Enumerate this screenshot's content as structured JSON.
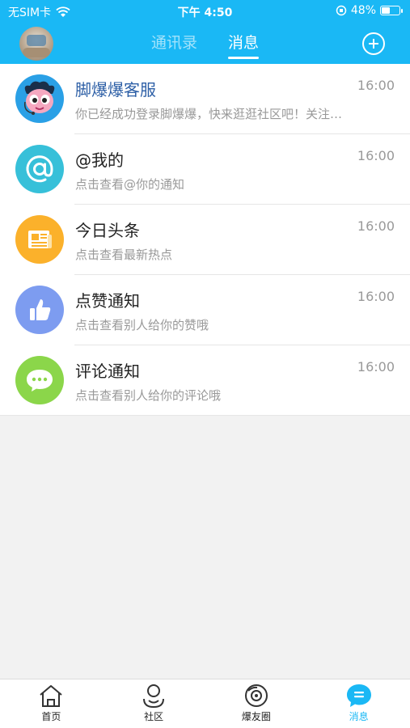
{
  "status_bar": {
    "carrier": "无SIM卡",
    "time": "下午 4:50",
    "battery": "48%",
    "battery_level": 0.48
  },
  "header": {
    "tabs": [
      {
        "label": "通讯录",
        "active": false
      },
      {
        "label": "消息",
        "active": true
      }
    ],
    "accent_color": "#1ab8f5"
  },
  "messages": [
    {
      "title": "脚爆爆客服",
      "subtitle": "你已经成功登录脚爆爆，快来逛逛社区吧！关注…",
      "time": "16:00",
      "icon": "customer-service-mascot-icon",
      "color": "#2aa0e6"
    },
    {
      "title": "@我的",
      "subtitle": "点击查看@你的通知",
      "time": "16:00",
      "icon": "at-sign-icon",
      "color": "#37c0d9"
    },
    {
      "title": "今日头条",
      "subtitle": "点击查看最新热点",
      "time": "16:00",
      "icon": "newspaper-icon",
      "color": "#fbb12b"
    },
    {
      "title": "点赞通知",
      "subtitle": "点击查看别人给你的赞哦",
      "time": "16:00",
      "icon": "thumbs-up-icon",
      "color": "#7d9cf0"
    },
    {
      "title": "评论通知",
      "subtitle": "点击查看别人给你的评论哦",
      "time": "16:00",
      "icon": "comment-bubble-icon",
      "color": "#8bd64a"
    }
  ],
  "bottom_nav": [
    {
      "label": "首页",
      "icon": "home-icon",
      "active": false
    },
    {
      "label": "社区",
      "icon": "community-icon",
      "active": false
    },
    {
      "label": "爆友圈",
      "icon": "friends-circle-icon",
      "active": false
    },
    {
      "label": "消息",
      "icon": "message-icon",
      "active": true
    }
  ]
}
